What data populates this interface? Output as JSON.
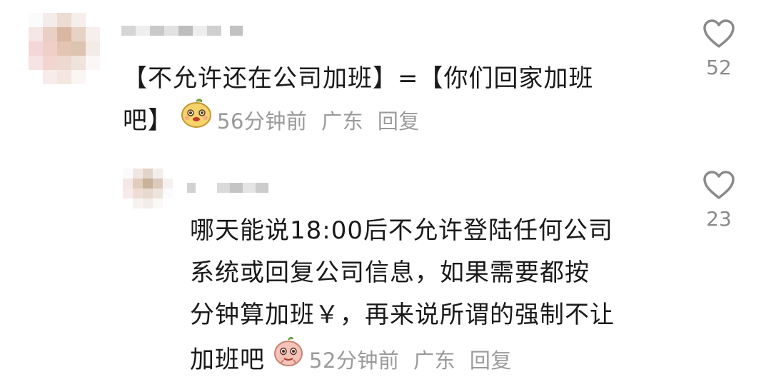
{
  "comments": [
    {
      "text_line1": "【不允许还在公司加班】=【你们回家加班",
      "text_line2": "吧】",
      "time": "56分钟前",
      "location": "广东",
      "reply_label": "回复",
      "likes": "52",
      "emoji_icon": "smiling-face-sticker-icon"
    },
    {
      "text_lines": [
        "哪天能说18:00后不允许登陆任何公司",
        "系统或回复公司信息，如果需要都按",
        "分钟算加班￥，再来说所谓的强制不让",
        "加班吧"
      ],
      "time": "52分钟前",
      "location": "广东",
      "reply_label": "回复",
      "likes": "23",
      "emoji_icon": "pink-face-sticker-icon"
    }
  ],
  "colors": {
    "text": "#1a1a1a",
    "meta": "#9a9a9a",
    "icon": "#8a8a8a"
  }
}
